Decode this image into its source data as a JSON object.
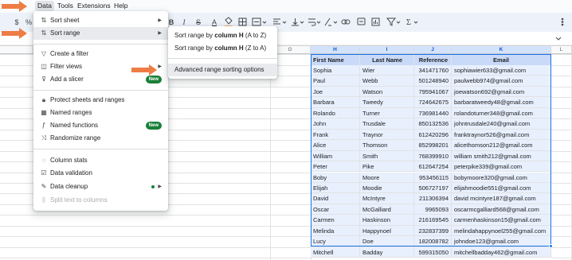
{
  "menubar": {
    "items": [
      {
        "label": "Data",
        "active": true
      },
      {
        "label": "Tools"
      },
      {
        "label": "Extensions"
      },
      {
        "label": "Help"
      }
    ]
  },
  "toolbar": {
    "left": [
      "$",
      "%"
    ],
    "bold": "B",
    "italic": "I",
    "strike": "S",
    "text_color": "A"
  },
  "data_menu": {
    "items": [
      {
        "icon": "sort-sheet-icon",
        "label": "Sort sheet",
        "submenu": true
      },
      {
        "icon": "sort-range-icon",
        "label": "Sort range",
        "submenu": true,
        "highlighted": true
      },
      {
        "icon": "filter-icon",
        "label": "Create a filter"
      },
      {
        "icon": "filter-views-icon",
        "label": "Filter views",
        "submenu": true
      },
      {
        "icon": "slicer-icon",
        "label": "Add a slicer",
        "badge": "New"
      },
      {
        "icon": "lock-icon",
        "label": "Protect sheets and ranges"
      },
      {
        "icon": "named-ranges-icon",
        "label": "Named ranges"
      },
      {
        "icon": "function-icon",
        "label": "Named functions",
        "badge": "New"
      },
      {
        "icon": "shuffle-icon",
        "label": "Randomize range"
      },
      {
        "icon": "lightbulb-icon",
        "label": "Column stats"
      },
      {
        "icon": "validation-icon",
        "label": "Data validation"
      },
      {
        "icon": "cleanup-icon",
        "label": "Data cleanup",
        "submenu": true,
        "dot": true
      },
      {
        "icon": "split-icon",
        "label": "Split text to columns",
        "disabled": true
      }
    ]
  },
  "sort_submenu": {
    "az_prefix": "Sort range by ",
    "az_col": "column H",
    "az_suffix": " (A to Z)",
    "za_prefix": "Sort range by ",
    "za_col": "column H",
    "za_suffix": " (Z to A)",
    "advanced": "Advanced range sorting options"
  },
  "grid": {
    "columns": [
      "G",
      "H",
      "I",
      "J",
      "K",
      "L"
    ],
    "headers": [
      "First Name",
      "Last Name",
      "Reference",
      "Email"
    ],
    "rows": [
      [
        "Sophia",
        "Wier",
        "341471760",
        "sophiawier633@gmail.com"
      ],
      [
        "Paul",
        "Webb",
        "501248940",
        "paulwebb974@gmail.com"
      ],
      [
        "Joe",
        "Watson",
        "795941067",
        "joewatson692@gmail.com"
      ],
      [
        "Barbara",
        "Tweedy",
        "724642675",
        "barbaratweedy48@gmail.com"
      ],
      [
        "Rolando",
        "Turner",
        "736981440",
        "rolandoturner348@gmail.com"
      ],
      [
        "John",
        "Trusdale",
        "850132536",
        "johntrusdale240@gmail.com"
      ],
      [
        "Frank",
        "Traynor",
        "612420296",
        "franktraynor526@gmail.com"
      ],
      [
        "Alice",
        "Thomson",
        "852998201",
        "alicethomson212@gmail.com"
      ],
      [
        "William",
        "Smith",
        "768399910",
        "william smith212@gmail.com"
      ],
      [
        "Peter",
        "Pike",
        "612647254",
        "peterpike339@gmail.com"
      ],
      [
        "Boby",
        "Moore",
        "953456115",
        "bobymoore320@gmail.com"
      ],
      [
        "Elijah",
        "Moodie",
        "506727197",
        "elijahmoodie551@gmail.com"
      ],
      [
        "David",
        "McIntyre",
        "211306394",
        "david mcintyre187@gmail.com"
      ],
      [
        "Oscar",
        "McGalliard",
        "9965093",
        "oscarmcgalliard568@gmail.com"
      ],
      [
        "Carmen",
        "Haskinson",
        "216169545",
        "carmenhaskinson15@gmail.com"
      ],
      [
        "Melinda",
        "Happynoel",
        "232837399",
        "melindahappynoel255@gmail.com"
      ],
      [
        "Lucy",
        "Doe",
        "182008782",
        "johndoe123@gmail.com"
      ],
      [
        "Mitchell",
        "Badday",
        "599315050",
        "mitchellbadday462@gmail.com"
      ]
    ]
  },
  "colors": {
    "accent": "#1a73e8",
    "header_fill": "#c9daf8",
    "selection": "#e8f0fe",
    "arrow": "#ee7d45",
    "badge": "#188038"
  }
}
